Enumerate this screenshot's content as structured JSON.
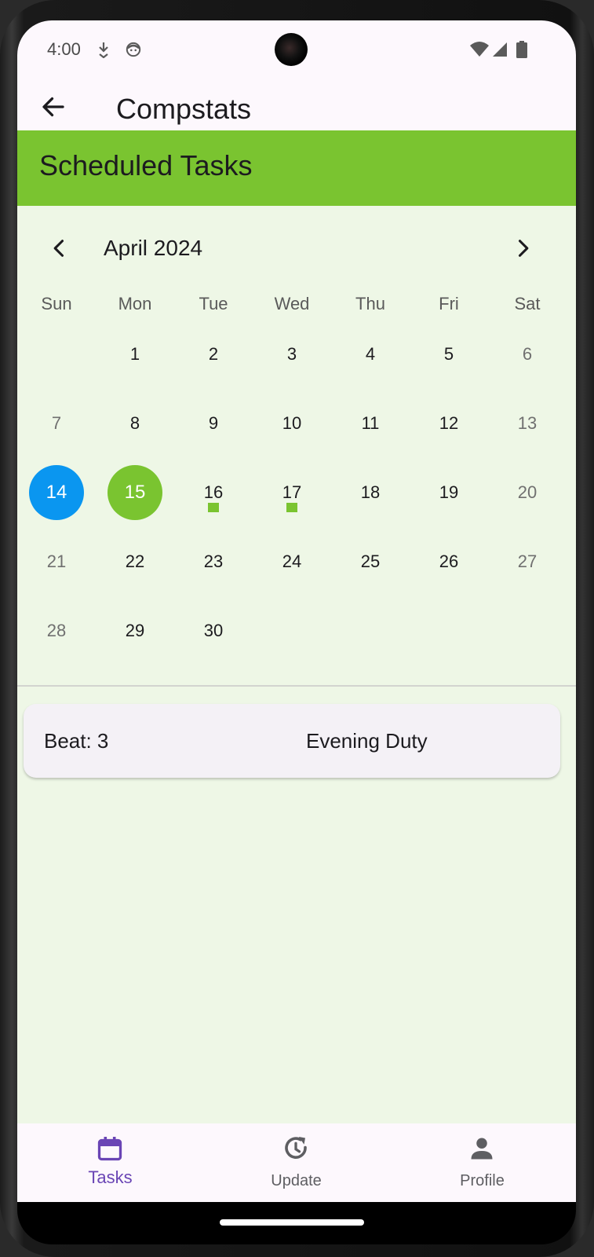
{
  "status_bar": {
    "time": "4:00",
    "icons_left": [
      "download-icon",
      "face-icon"
    ],
    "icons_right": [
      "wifi-icon",
      "signal-icon",
      "battery-icon"
    ]
  },
  "app_bar": {
    "back_icon": "arrow-back-icon",
    "title": "Compstats"
  },
  "banner": {
    "title": "Scheduled Tasks",
    "color": "#7ac430"
  },
  "calendar": {
    "month_label": "April 2024",
    "prev_icon": "chevron-left-icon",
    "next_icon": "chevron-right-icon",
    "weekdays": [
      "Sun",
      "Mon",
      "Tue",
      "Wed",
      "Thu",
      "Fri",
      "Sat"
    ],
    "weeks": [
      [
        "",
        "1",
        "2",
        "3",
        "4",
        "5",
        "6"
      ],
      [
        "7",
        "8",
        "9",
        "10",
        "11",
        "12",
        "13"
      ],
      [
        "14",
        "15",
        "16",
        "17",
        "18",
        "19",
        "20"
      ],
      [
        "21",
        "22",
        "23",
        "24",
        "25",
        "26",
        "27"
      ],
      [
        "28",
        "29",
        "30",
        "",
        "",
        "",
        ""
      ]
    ],
    "selected_day": "14",
    "selected_color": "#0a96f0",
    "today": "15",
    "today_color": "#7ac430",
    "days_with_tasks": [
      "15",
      "16",
      "17"
    ]
  },
  "tasks": [
    {
      "beat": "Beat: 3",
      "name": "Evening Duty"
    }
  ],
  "bottom_nav": {
    "items": [
      {
        "label": "Tasks",
        "icon": "calendar-icon",
        "active": true
      },
      {
        "label": "Update",
        "icon": "update-icon",
        "active": false
      },
      {
        "label": "Profile",
        "icon": "person-icon",
        "active": false
      }
    ],
    "active_color": "#6a45b5"
  }
}
